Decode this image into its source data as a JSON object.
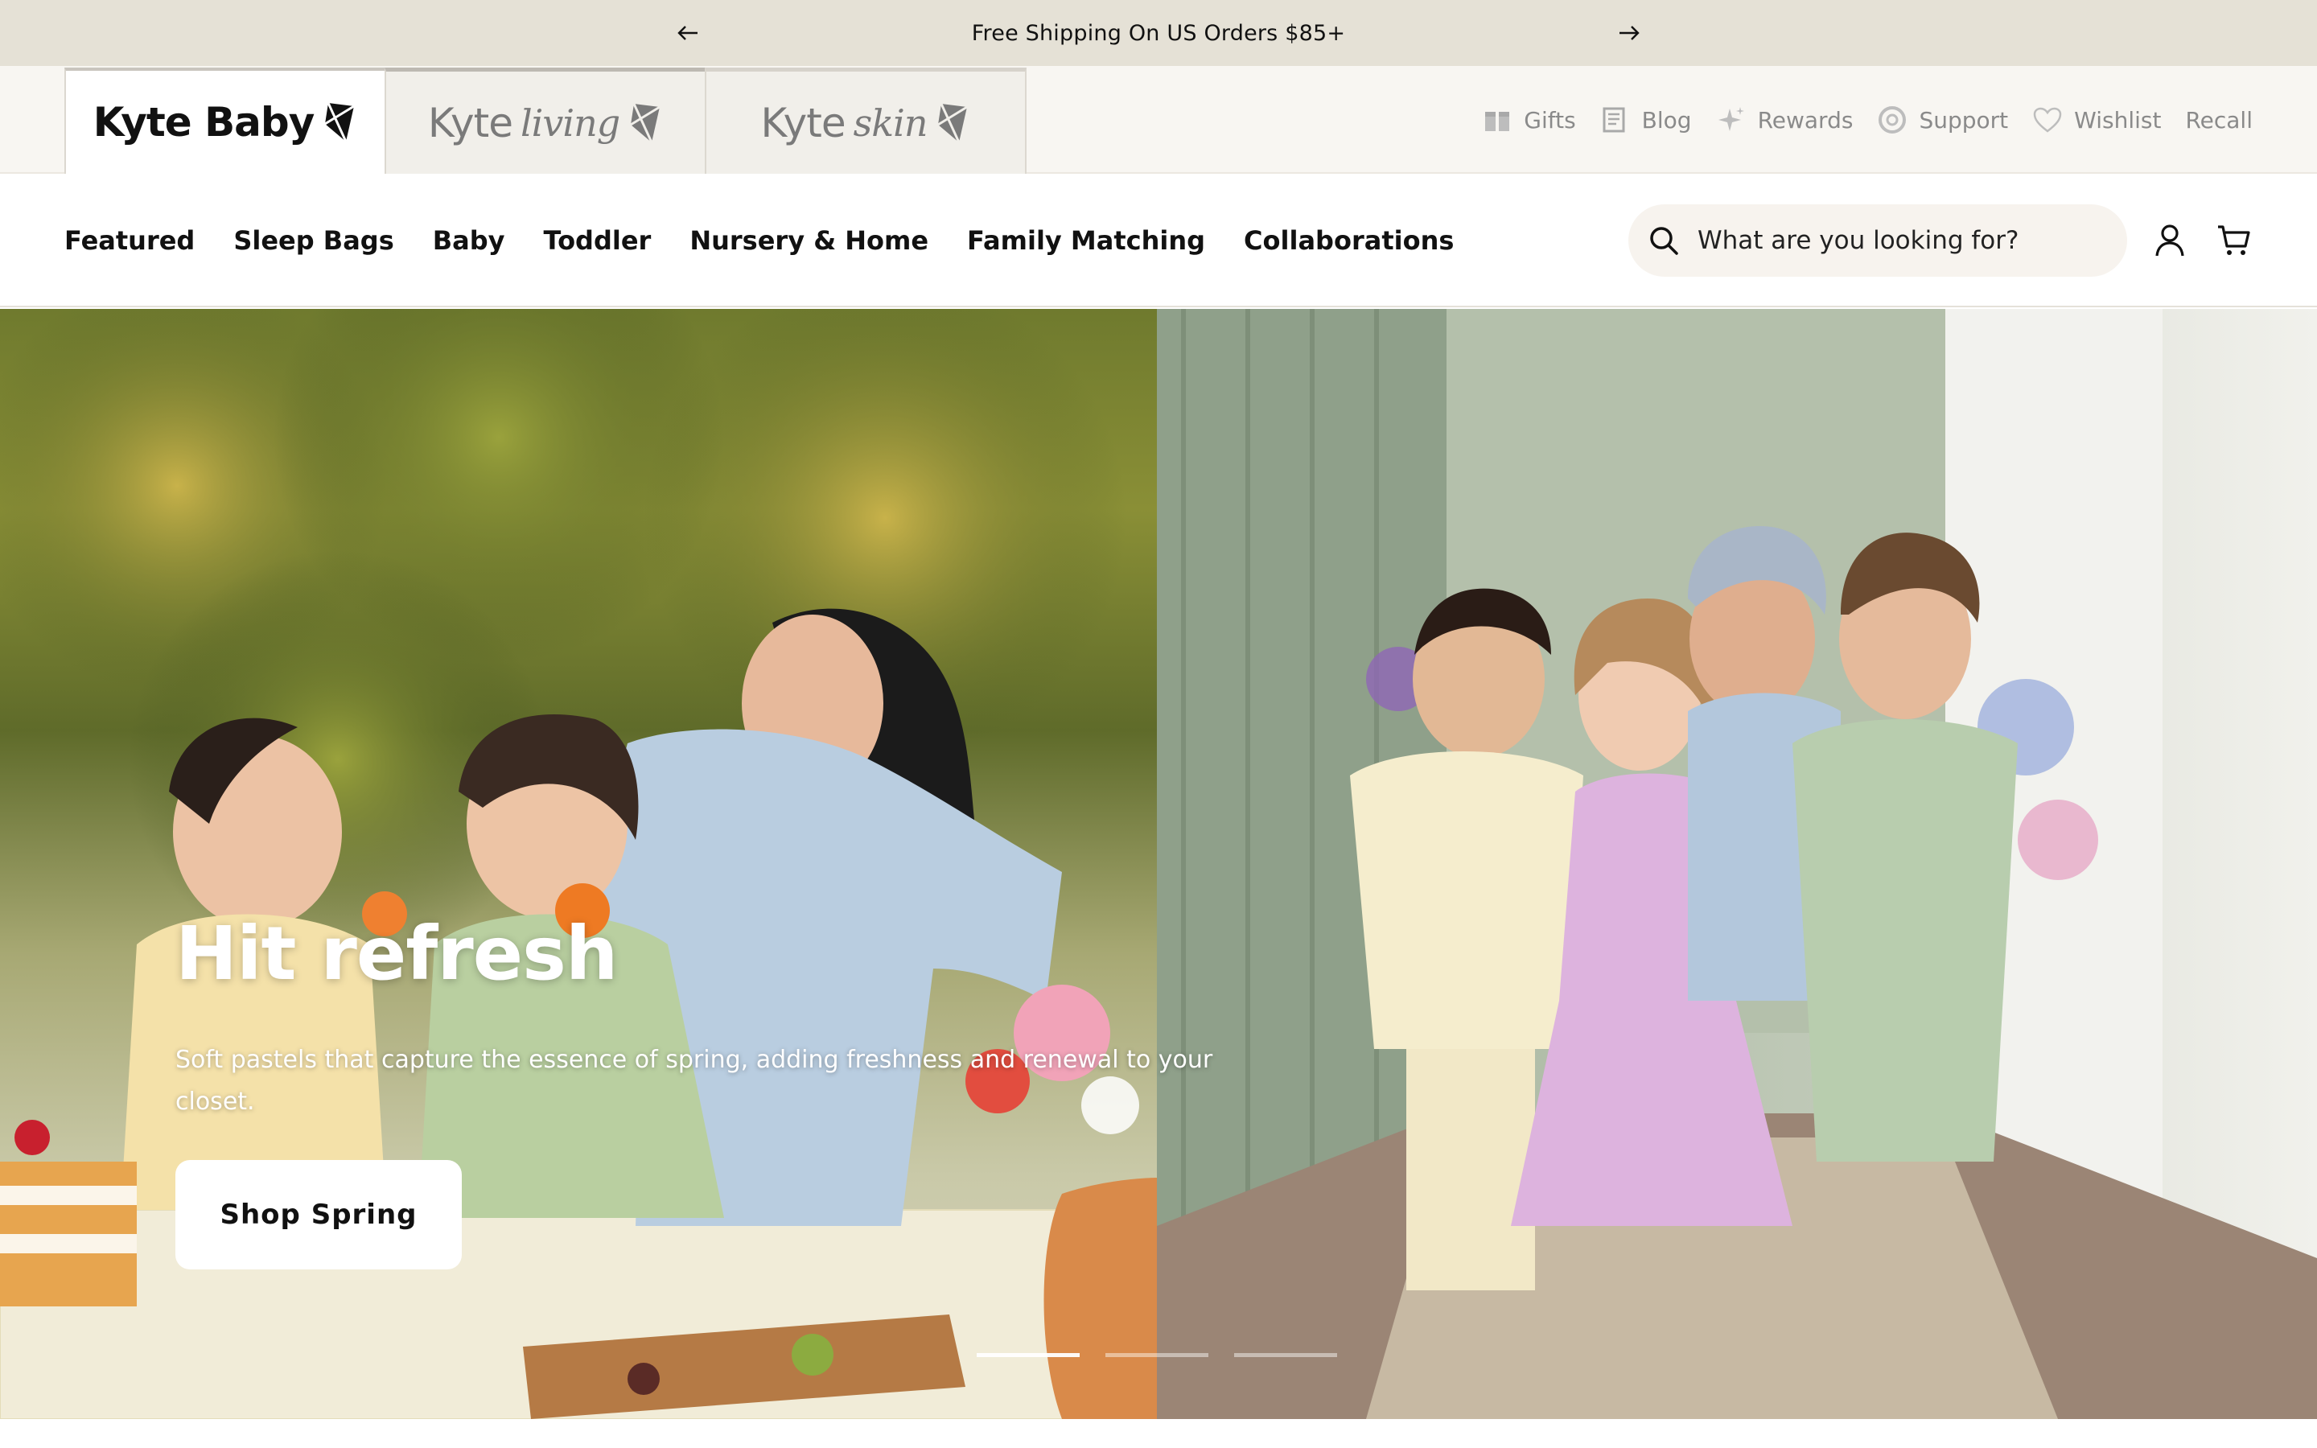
{
  "announcement": {
    "text": "Free Shipping On US Orders $85+"
  },
  "brands": [
    {
      "word": "Kyte Baby",
      "script": ""
    },
    {
      "word": "Kyte",
      "script": "living"
    },
    {
      "word": "Kyte",
      "script": "skin"
    }
  ],
  "utility": [
    {
      "label": "Gifts",
      "icon": "gift-icon"
    },
    {
      "label": "Blog",
      "icon": "blog-icon"
    },
    {
      "label": "Rewards",
      "icon": "sparkle-icon"
    },
    {
      "label": "Support",
      "icon": "lifebuoy-icon"
    },
    {
      "label": "Wishlist",
      "icon": "heart-icon"
    },
    {
      "label": "Recall",
      "icon": ""
    }
  ],
  "nav": [
    "Featured",
    "Sleep Bags",
    "Baby",
    "Toddler",
    "Nursery & Home",
    "Family Matching",
    "Collaborations"
  ],
  "search": {
    "placeholder": "What are you looking for?"
  },
  "hero": {
    "title": "Hit refresh",
    "subtitle": "Soft pastels that capture the essence of spring, adding freshness and renewal to your closet.",
    "cta": "Shop Spring",
    "slides_total": 3,
    "active_slide": 1
  },
  "colors": {
    "announce_bg": "#e5e1d6",
    "brand_row_bg": "#f8f6f2",
    "search_bg": "#f7f3ee",
    "text": "#111111",
    "muted": "#8a8a8a"
  }
}
